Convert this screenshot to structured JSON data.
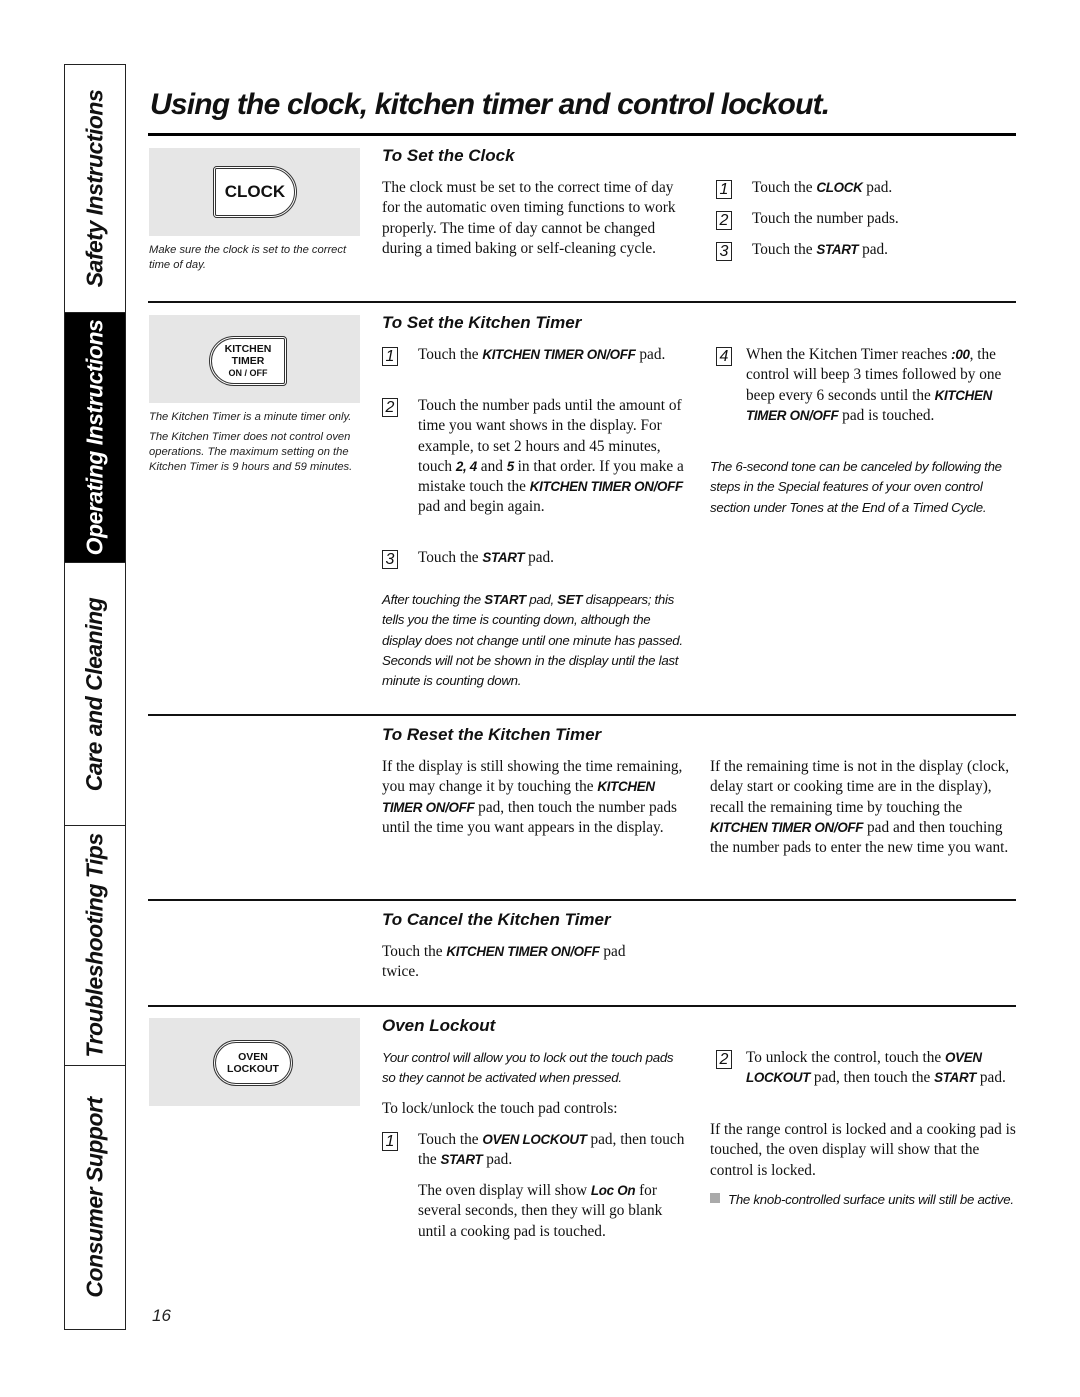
{
  "side_tabs": [
    {
      "label": "Safety Instructions",
      "active": false
    },
    {
      "label": "Operating Instructions",
      "active": true
    },
    {
      "label": "Care and Cleaning",
      "active": false
    },
    {
      "label": "Troubleshooting Tips",
      "active": false
    },
    {
      "label": "Consumer Support",
      "active": false
    }
  ],
  "page_title": "Using the clock, kitchen timer and control lockout.",
  "page_number": "16",
  "set_clock": {
    "pad_label": "CLOCK",
    "caption": "Make sure the clock is set to the correct time of day.",
    "heading": "To Set the Clock",
    "intro": "The clock must be set to the correct time of day for the automatic oven timing functions to work properly. The time of day cannot be changed during a timed baking or self-cleaning cycle.",
    "steps": [
      {
        "num": "1",
        "pre": "Touch the ",
        "bold": "CLOCK",
        "post": " pad."
      },
      {
        "num": "2",
        "pre": "Touch the number pads.",
        "bold": "",
        "post": ""
      },
      {
        "num": "3",
        "pre": "Touch the ",
        "bold": "START",
        "post": " pad."
      }
    ]
  },
  "set_timer": {
    "pad_line1": "KITCHEN",
    "pad_line2": "TIMER",
    "pad_line3": "ON / OFF",
    "caption1": "The Kitchen Timer is a minute timer only.",
    "caption2": "The Kitchen Timer does not control oven operations. The maximum setting on the Kitchen Timer is 9 hours and 59 minutes.",
    "heading": "To Set the Kitchen Timer",
    "step1": {
      "num": "1",
      "pre": "Touch the ",
      "bold": "KITCHEN TIMER ON/OFF",
      "post": " pad."
    },
    "step2": {
      "num": "2",
      "t1": "Touch the number pads until the amount of time you want shows in the display. For example, to set 2 hours and 45 minutes, touch ",
      "b1": "2, 4",
      "t2": " and ",
      "b2": "5",
      "t3": " in that order. If you make a mistake touch the ",
      "b3": "KITCHEN TIMER ON/OFF",
      "t4": " pad and begin again."
    },
    "step3": {
      "num": "3",
      "pre": "Touch the ",
      "bold": "START",
      "post": " pad."
    },
    "note": {
      "t1": "After touching the ",
      "b1": "START",
      "t2": " pad, ",
      "b2": "SET",
      "t3": " disappears; this tells you the time is counting down, although the display does not change until one minute has passed. Seconds will not be shown in the display until the last minute is counting down."
    },
    "step4": {
      "num": "4",
      "t1": "When the Kitchen Timer reaches ",
      "b1": ":00",
      "t2": ", the control will beep 3 times followed by one beep every 6 seconds until the ",
      "b2": "KITCHEN TIMER ON/OFF",
      "t3": " pad is touched."
    },
    "tone_note": "The 6-second tone can be canceled by following the steps in the Special features of your oven control section under Tones at the End of a Timed Cycle."
  },
  "reset_timer": {
    "heading": "To Reset the Kitchen Timer",
    "left": {
      "t1": "If the display is still showing the time remaining, you may change it by touching the ",
      "b1": "KITCHEN TIMER ON/OFF",
      "t2": " pad, then touch the number pads until the time you want appears in the display."
    },
    "right": {
      "t1": "If the remaining time is not in the display (clock, delay start or cooking time are in the display), recall the remaining time by touching the ",
      "b1": "KITCHEN TIMER ON/OFF",
      "t2": " pad and then touching the number pads to enter the new time you want."
    }
  },
  "cancel_timer": {
    "heading": "To Cancel the Kitchen Timer",
    "t1": "Touch the ",
    "b1": "KITCHEN TIMER ON/OFF",
    "t2": " pad twice."
  },
  "oven_lockout": {
    "pad_line1": "OVEN",
    "pad_line2": "LOCKOUT",
    "heading": "Oven Lockout",
    "intro_note": "Your control will allow you to lock out the touch pads so they cannot be activated when pressed.",
    "lead": "To lock/unlock the touch pad controls:",
    "step1": {
      "num": "1",
      "t1": "Touch the ",
      "b1": "OVEN LOCKOUT",
      "t2": " pad, then touch the ",
      "b2": "START",
      "t3": " pad."
    },
    "display_note": {
      "t1": "The oven display will show ",
      "b1": "Loc On",
      "t2": " for several seconds, then they will go blank until a cooking pad is touched."
    },
    "step2": {
      "num": "2",
      "t1": "To unlock the control, touch the ",
      "b1": "OVEN LOCKOUT",
      "t2": " pad, then touch the ",
      "b2": "START",
      "t3": " pad."
    },
    "locked_info": "If the range control is locked and a cooking pad is touched, the oven display will show that the control is locked.",
    "bullet_note": "The knob-controlled surface units will still be active."
  }
}
